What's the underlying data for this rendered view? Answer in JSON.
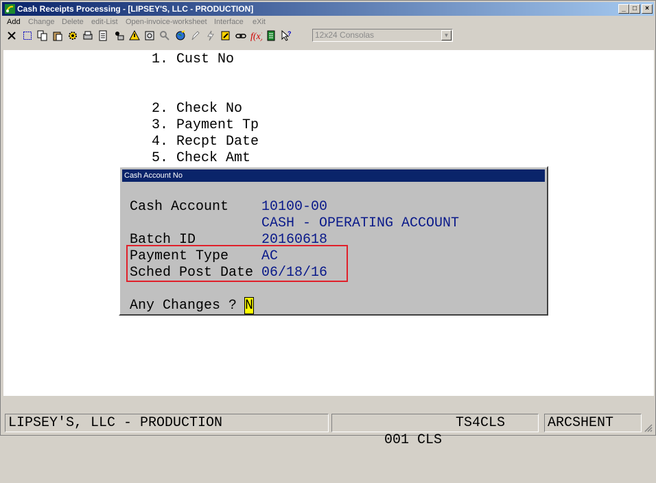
{
  "window": {
    "title": "Cash Receipts Processing - [LIPSEY'S, LLC - PRODUCTION]",
    "minimize": "_",
    "maximize": "□",
    "close": "×"
  },
  "menu": {
    "items": [
      "Add",
      "Change",
      "Delete",
      "edit-List",
      "Open-invoice-worksheet",
      "Interface",
      "eXit"
    ]
  },
  "toolbar": {
    "font_select": "12x24 Consolas",
    "icons": [
      "close-x-icon",
      "select-icon",
      "copy-icon",
      "paste-icon",
      "gear-icon",
      "print-setup-icon",
      "document-icon",
      "user-print-icon",
      "alert-icon",
      "zoom-icon",
      "search-icon",
      "globe-icon",
      "pen-icon",
      "lightning-icon",
      "edit-icon",
      "link-icon",
      "function-icon",
      "notes-icon",
      "help-pointer-icon"
    ]
  },
  "screen": {
    "lines": [
      {
        "text": "1. Cust No"
      },
      {
        "text": "2. Check No"
      },
      {
        "text": "3. Payment Tp"
      },
      {
        "text": "4. Recpt Date"
      },
      {
        "text": "5. Check Amt"
      }
    ]
  },
  "dialog": {
    "title": "Cash Account No",
    "cash_account_label": "Cash Account",
    "cash_account_value": "10100-00",
    "cash_account_desc": "CASH - OPERATING ACCOUNT",
    "batch_id_label": "Batch ID",
    "batch_id_value": "20160618",
    "payment_type_label": "Payment Type",
    "payment_type_value": "AC",
    "sched_post_date_label": "Sched Post Date",
    "sched_post_date_value": "06/18/16",
    "any_changes_label": "Any Changes ?",
    "any_changes_value": "N"
  },
  "status": {
    "company": "LIPSEY'S, LLC - PRODUCTION",
    "company_code": "001 CLS",
    "terminal": "TS4CLS",
    "user": "ARCSHENT"
  }
}
